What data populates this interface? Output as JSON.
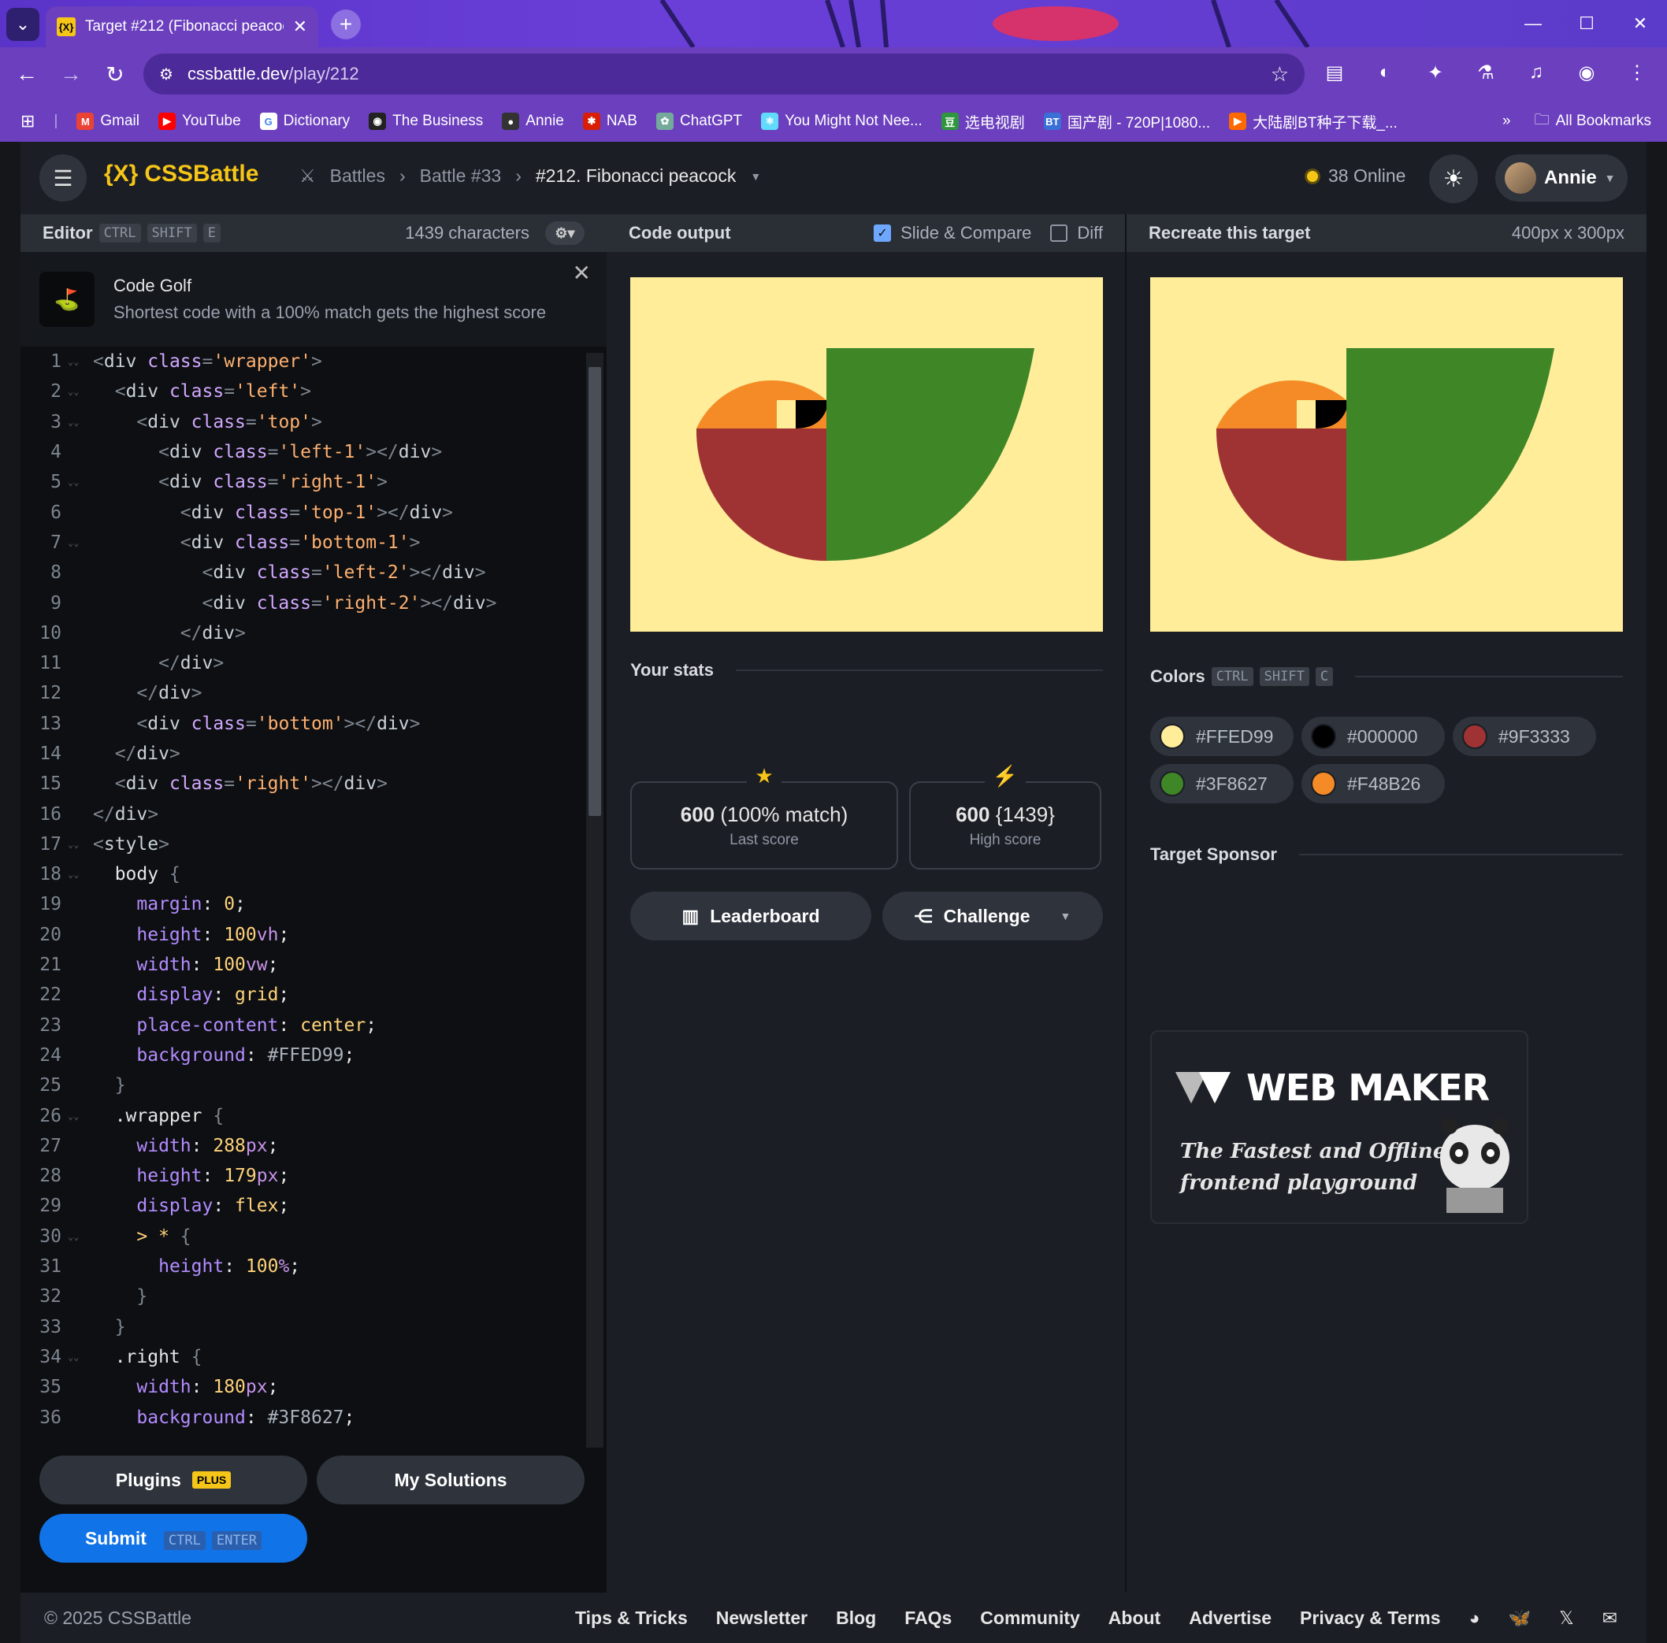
{
  "browser": {
    "tab_title": "Target #212 (Fibonacci peacock",
    "tab_favicon": "{X}",
    "url_host": "cssbattle.dev",
    "url_path": "/play/212",
    "bookmarks": [
      {
        "label": "Gmail",
        "icon": "gmail-icon",
        "color": "#ea4335",
        "glyph": "M"
      },
      {
        "label": "YouTube",
        "icon": "youtube-icon",
        "color": "#ff0000",
        "glyph": "▶"
      },
      {
        "label": "Dictionary",
        "icon": "google-icon",
        "color": "#ffffff",
        "glyph": "G"
      },
      {
        "label": "The Business",
        "icon": "abc-icon",
        "color": "#222222",
        "glyph": "◉"
      },
      {
        "label": "Annie",
        "icon": "github-icon",
        "color": "#333333",
        "glyph": "●"
      },
      {
        "label": "NAB",
        "icon": "nab-icon",
        "color": "#d81e05",
        "glyph": "✱"
      },
      {
        "label": "ChatGPT",
        "icon": "chatgpt-icon",
        "color": "#74aa9c",
        "glyph": "✿"
      },
      {
        "label": "You Might Not Nee...",
        "icon": "react-icon",
        "color": "#61dafb",
        "glyph": "⚛"
      },
      {
        "label": "选电视剧",
        "icon": "douban-icon",
        "color": "#2e963d",
        "glyph": "豆"
      },
      {
        "label": "国产剧 - 720P|1080...",
        "icon": "bt-icon",
        "color": "#3a6fd8",
        "glyph": "BT"
      },
      {
        "label": "大陆剧BT种子下载_...",
        "icon": "play-icon",
        "color": "#ff6a00",
        "glyph": "▶"
      }
    ],
    "more_bookmarks": "»",
    "all_bookmarks": "All Bookmarks"
  },
  "app": {
    "logo": "CSSBattle",
    "logo_mark": "{X}",
    "breadcrumb": [
      "Battles",
      "Battle #33",
      "#212. Fibonacci peacock"
    ],
    "online": "38 Online",
    "user": "Annie"
  },
  "editor": {
    "title": "Editor",
    "shortcut": [
      "CTRL",
      "SHIFT",
      "E"
    ],
    "char_count": "1439 characters",
    "golf_title": "Code Golf",
    "golf_subtitle": "Shortest code with a 100% match gets the highest score",
    "code_lines": [
      [
        [
          "c-punc",
          "<"
        ],
        [
          "c-tag",
          "div "
        ],
        [
          "c-attr",
          "class"
        ],
        [
          "c-punc",
          "="
        ],
        [
          "c-str",
          "'wrapper'"
        ],
        [
          "c-punc",
          ">"
        ]
      ],
      [
        [
          "c-sel",
          "  "
        ],
        [
          "c-punc",
          "<"
        ],
        [
          "c-tag",
          "div "
        ],
        [
          "c-attr",
          "class"
        ],
        [
          "c-punc",
          "="
        ],
        [
          "c-str",
          "'left'"
        ],
        [
          "c-punc",
          ">"
        ]
      ],
      [
        [
          "c-sel",
          "    "
        ],
        [
          "c-punc",
          "<"
        ],
        [
          "c-tag",
          "div "
        ],
        [
          "c-attr",
          "class"
        ],
        [
          "c-punc",
          "="
        ],
        [
          "c-str",
          "'top'"
        ],
        [
          "c-punc",
          ">"
        ]
      ],
      [
        [
          "c-sel",
          "      "
        ],
        [
          "c-punc",
          "<"
        ],
        [
          "c-tag",
          "div "
        ],
        [
          "c-attr",
          "class"
        ],
        [
          "c-punc",
          "="
        ],
        [
          "c-str",
          "'left-1'"
        ],
        [
          "c-punc",
          "></"
        ],
        [
          "c-tag",
          "div"
        ],
        [
          "c-punc",
          ">"
        ]
      ],
      [
        [
          "c-sel",
          "      "
        ],
        [
          "c-punc",
          "<"
        ],
        [
          "c-tag",
          "div "
        ],
        [
          "c-attr",
          "class"
        ],
        [
          "c-punc",
          "="
        ],
        [
          "c-str",
          "'right-1'"
        ],
        [
          "c-punc",
          ">"
        ]
      ],
      [
        [
          "c-sel",
          "        "
        ],
        [
          "c-punc",
          "<"
        ],
        [
          "c-tag",
          "div "
        ],
        [
          "c-attr",
          "class"
        ],
        [
          "c-punc",
          "="
        ],
        [
          "c-str",
          "'top-1'"
        ],
        [
          "c-punc",
          "></"
        ],
        [
          "c-tag",
          "div"
        ],
        [
          "c-punc",
          ">"
        ]
      ],
      [
        [
          "c-sel",
          "        "
        ],
        [
          "c-punc",
          "<"
        ],
        [
          "c-tag",
          "div "
        ],
        [
          "c-attr",
          "class"
        ],
        [
          "c-punc",
          "="
        ],
        [
          "c-str",
          "'bottom-1'"
        ],
        [
          "c-punc",
          ">"
        ]
      ],
      [
        [
          "c-sel",
          "          "
        ],
        [
          "c-punc",
          "<"
        ],
        [
          "c-tag",
          "div "
        ],
        [
          "c-attr",
          "class"
        ],
        [
          "c-punc",
          "="
        ],
        [
          "c-str",
          "'left-2'"
        ],
        [
          "c-punc",
          "></"
        ],
        [
          "c-tag",
          "div"
        ],
        [
          "c-punc",
          ">"
        ]
      ],
      [
        [
          "c-sel",
          "          "
        ],
        [
          "c-punc",
          "<"
        ],
        [
          "c-tag",
          "div "
        ],
        [
          "c-attr",
          "class"
        ],
        [
          "c-punc",
          "="
        ],
        [
          "c-str",
          "'right-2'"
        ],
        [
          "c-punc",
          "></"
        ],
        [
          "c-tag",
          "div"
        ],
        [
          "c-punc",
          ">"
        ]
      ],
      [
        [
          "c-sel",
          "        "
        ],
        [
          "c-punc",
          "</"
        ],
        [
          "c-tag",
          "div"
        ],
        [
          "c-punc",
          ">"
        ]
      ],
      [
        [
          "c-sel",
          "      "
        ],
        [
          "c-punc",
          "</"
        ],
        [
          "c-tag",
          "div"
        ],
        [
          "c-punc",
          ">"
        ]
      ],
      [
        [
          "c-sel",
          "    "
        ],
        [
          "c-punc",
          "</"
        ],
        [
          "c-tag",
          "div"
        ],
        [
          "c-punc",
          ">"
        ]
      ],
      [
        [
          "c-sel",
          "    "
        ],
        [
          "c-punc",
          "<"
        ],
        [
          "c-tag",
          "div "
        ],
        [
          "c-attr",
          "class"
        ],
        [
          "c-punc",
          "="
        ],
        [
          "c-str",
          "'bottom'"
        ],
        [
          "c-punc",
          "></"
        ],
        [
          "c-tag",
          "div"
        ],
        [
          "c-punc",
          ">"
        ]
      ],
      [
        [
          "c-sel",
          "  "
        ],
        [
          "c-punc",
          "</"
        ],
        [
          "c-tag",
          "div"
        ],
        [
          "c-punc",
          ">"
        ]
      ],
      [
        [
          "c-sel",
          "  "
        ],
        [
          "c-punc",
          "<"
        ],
        [
          "c-tag",
          "div "
        ],
        [
          "c-attr",
          "class"
        ],
        [
          "c-punc",
          "="
        ],
        [
          "c-str",
          "'right'"
        ],
        [
          "c-punc",
          "></"
        ],
        [
          "c-tag",
          "div"
        ],
        [
          "c-punc",
          ">"
        ]
      ],
      [
        [
          "c-punc",
          "</"
        ],
        [
          "c-tag",
          "div"
        ],
        [
          "c-punc",
          ">"
        ]
      ],
      [
        [
          "c-punc",
          "<"
        ],
        [
          "c-tag",
          "style"
        ],
        [
          "c-punc",
          ">"
        ]
      ],
      [
        [
          "c-sel",
          "  body "
        ],
        [
          "c-punc",
          "{"
        ]
      ],
      [
        [
          "c-sel",
          "    "
        ],
        [
          "c-prop",
          "margin"
        ],
        [
          "c-sel",
          ": "
        ],
        [
          "c-val",
          "0"
        ],
        [
          "c-sel",
          ";"
        ]
      ],
      [
        [
          "c-sel",
          "    "
        ],
        [
          "c-prop",
          "height"
        ],
        [
          "c-sel",
          ": "
        ],
        [
          "c-val",
          "100"
        ],
        [
          "c-unit",
          "vh"
        ],
        [
          "c-sel",
          ";"
        ]
      ],
      [
        [
          "c-sel",
          "    "
        ],
        [
          "c-prop",
          "width"
        ],
        [
          "c-sel",
          ": "
        ],
        [
          "c-val",
          "100"
        ],
        [
          "c-unit",
          "vw"
        ],
        [
          "c-sel",
          ";"
        ]
      ],
      [
        [
          "c-sel",
          "    "
        ],
        [
          "c-prop",
          "display"
        ],
        [
          "c-sel",
          ": "
        ],
        [
          "c-val",
          "grid"
        ],
        [
          "c-sel",
          ";"
        ]
      ],
      [
        [
          "c-sel",
          "    "
        ],
        [
          "c-prop",
          "place-content"
        ],
        [
          "c-sel",
          ": "
        ],
        [
          "c-val",
          "center"
        ],
        [
          "c-sel",
          ";"
        ]
      ],
      [
        [
          "c-sel",
          "    "
        ],
        [
          "c-prop",
          "background"
        ],
        [
          "c-sel",
          ": "
        ],
        [
          "c-hex",
          "#FFED99"
        ],
        [
          "c-sel",
          ";"
        ]
      ],
      [
        [
          "c-sel",
          "  "
        ],
        [
          "c-punc",
          "}"
        ]
      ],
      [
        [
          "c-sel",
          "  .wrapper "
        ],
        [
          "c-punc",
          "{"
        ]
      ],
      [
        [
          "c-sel",
          "    "
        ],
        [
          "c-prop",
          "width"
        ],
        [
          "c-sel",
          ": "
        ],
        [
          "c-val",
          "288"
        ],
        [
          "c-unit",
          "px"
        ],
        [
          "c-sel",
          ";"
        ]
      ],
      [
        [
          "c-sel",
          "    "
        ],
        [
          "c-prop",
          "height"
        ],
        [
          "c-sel",
          ": "
        ],
        [
          "c-val",
          "179"
        ],
        [
          "c-unit",
          "px"
        ],
        [
          "c-sel",
          ";"
        ]
      ],
      [
        [
          "c-sel",
          "    "
        ],
        [
          "c-prop",
          "display"
        ],
        [
          "c-sel",
          ": "
        ],
        [
          "c-val",
          "flex"
        ],
        [
          "c-sel",
          ";"
        ]
      ],
      [
        [
          "c-sel",
          "    "
        ],
        [
          "c-val",
          "> * "
        ],
        [
          "c-punc",
          "{"
        ]
      ],
      [
        [
          "c-sel",
          "      "
        ],
        [
          "c-prop",
          "height"
        ],
        [
          "c-sel",
          ": "
        ],
        [
          "c-val",
          "100"
        ],
        [
          "c-unit",
          "%"
        ],
        [
          "c-sel",
          ";"
        ]
      ],
      [
        [
          "c-sel",
          "    "
        ],
        [
          "c-punc",
          "}"
        ]
      ],
      [
        [
          "c-sel",
          "  "
        ],
        [
          "c-punc",
          "}"
        ]
      ],
      [
        [
          "c-sel",
          "  .right "
        ],
        [
          "c-punc",
          "{"
        ]
      ],
      [
        [
          "c-sel",
          "    "
        ],
        [
          "c-prop",
          "width"
        ],
        [
          "c-sel",
          ": "
        ],
        [
          "c-val",
          "180"
        ],
        [
          "c-unit",
          "px"
        ],
        [
          "c-sel",
          ";"
        ]
      ],
      [
        [
          "c-sel",
          "    "
        ],
        [
          "c-prop",
          "background"
        ],
        [
          "c-sel",
          ": "
        ],
        [
          "c-hex",
          "#3F8627"
        ],
        [
          "c-sel",
          ";"
        ]
      ]
    ],
    "folds": [
      1,
      2,
      3,
      5,
      7,
      17,
      18,
      26,
      30,
      34
    ],
    "plugins_label": "Plugins",
    "plugins_badge": "PLUS",
    "solutions_label": "My Solutions",
    "submit_label": "Submit",
    "submit_shortcut": [
      "CTRL",
      "ENTER"
    ]
  },
  "output": {
    "title": "Code output",
    "slide_compare": "Slide & Compare",
    "slide_compare_checked": true,
    "diff": "Diff",
    "diff_checked": false,
    "stats_title": "Your stats",
    "last_score_value": "600",
    "last_score_match": "(100% match)",
    "last_score_label": "Last score",
    "high_score_value": "600",
    "high_score_chars": "{1439}",
    "high_score_label": "High score",
    "leaderboard_label": "Leaderboard",
    "challenge_label": "Challenge"
  },
  "target": {
    "title": "Recreate this target",
    "size": "400px x 300px",
    "colors_title": "Colors",
    "colors_shortcut": [
      "CTRL",
      "SHIFT",
      "C"
    ],
    "colors": [
      {
        "hex": "#FFED99"
      },
      {
        "hex": "#000000"
      },
      {
        "hex": "#9F3333"
      },
      {
        "hex": "#3F8627"
      },
      {
        "hex": "#F48B26"
      }
    ],
    "sponsor_title": "Target Sponsor",
    "sponsor_brand": "WEB MAKER",
    "sponsor_tagline_1": "The Fastest and Offline",
    "sponsor_tagline_2": "frontend playground"
  },
  "footer": {
    "copyright": "© 2025 CSSBattle",
    "links": [
      "Tips & Tricks",
      "Newsletter",
      "Blog",
      "FAQs",
      "Community",
      "About",
      "Advertise",
      "Privacy & Terms"
    ]
  },
  "palette": {
    "yellow": "#FFED99",
    "black": "#000000",
    "red": "#9F3333",
    "green": "#3F8627",
    "orange": "#F48B26",
    "accent": "#f5c518",
    "submit": "#1173e8"
  }
}
